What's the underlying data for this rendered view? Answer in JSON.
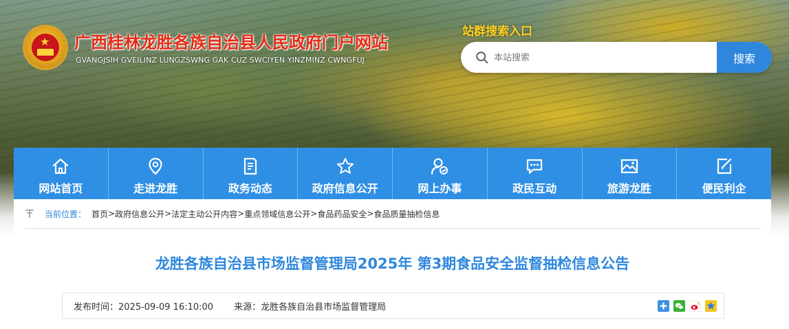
{
  "header": {
    "site_title": "广西桂林龙胜各族自治县人民政府门户网站",
    "site_subtitle": "GVANGJSIH GVEILINZ LUNGZSWNG GAK CUZ SWCIYEN YINZMINZ CWNGFUJ",
    "emblem_icon": "national-emblem-icon"
  },
  "search": {
    "title": "站群搜索入口",
    "placeholder": "本站搜索",
    "button_label": "搜索",
    "icon": "search-icon"
  },
  "nav": {
    "items": [
      {
        "label": "网站首页",
        "icon": "home-icon"
      },
      {
        "label": "走进龙胜",
        "icon": "location-pin-icon"
      },
      {
        "label": "政务动态",
        "icon": "document-edit-icon"
      },
      {
        "label": "政府信息公开",
        "icon": "star-icon"
      },
      {
        "label": "网上办事",
        "icon": "user-service-icon"
      },
      {
        "label": "政民互动",
        "icon": "chat-bubble-icon"
      },
      {
        "label": "旅游龙胜",
        "icon": "landscape-image-icon"
      },
      {
        "label": "便民利企",
        "icon": "edit-check-icon"
      }
    ]
  },
  "breadcrumb": {
    "lead": "当前位置：",
    "items": [
      "首页",
      "政府信息公开",
      "法定主动公开内容",
      "重点领域信息公开",
      "食品药品安全",
      "食品质量抽检信息"
    ]
  },
  "article": {
    "title": "龙胜各族自治县市场监督管理局2025年 第3期食品安全监督抽检信息公告",
    "publish_time": "发布时间：2025-09-09 16:10:00",
    "source": "来源：龙胜各族自治县市场监督管理局",
    "share_icons": [
      "qzone-share-icon",
      "wechat-share-icon",
      "weibo-share-icon",
      "qq-share-icon"
    ]
  },
  "colors": {
    "brand_blue": "#2e87dd",
    "nav_blue": "#2f8fe4",
    "title_red": "#e52b16",
    "search_title_yellow": "#ffd21f"
  }
}
